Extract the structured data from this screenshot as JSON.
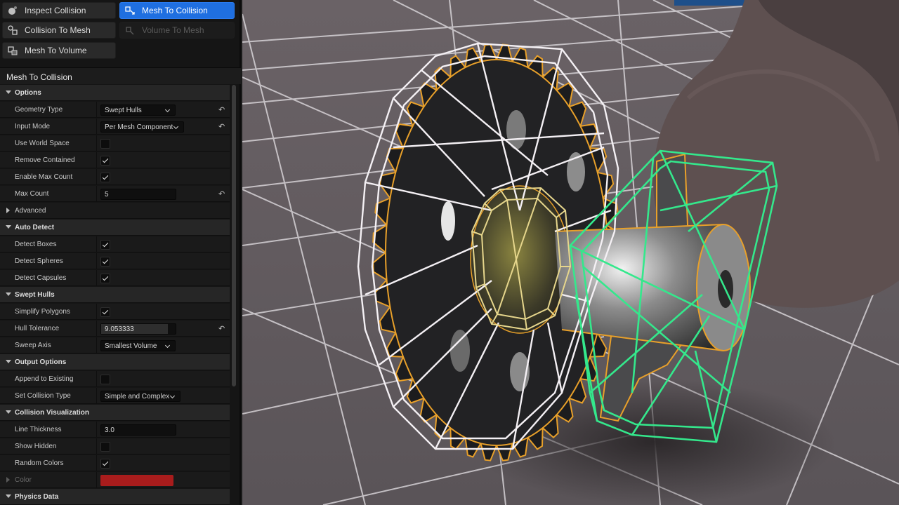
{
  "toolbar": {
    "inspect_collision": "Inspect Collision",
    "mesh_to_collision": "Mesh To Collision",
    "collision_to_mesh": "Collision To Mesh",
    "volume_to_mesh": "Volume To Mesh",
    "mesh_to_volume": "Mesh To Volume"
  },
  "panel_title": "Mesh To Collision",
  "options": {
    "section": "Options",
    "geometry_type": {
      "label": "Geometry Type",
      "value": "Swept Hulls"
    },
    "input_mode": {
      "label": "Input Mode",
      "value": "Per Mesh Component"
    },
    "use_world_space": {
      "label": "Use World Space",
      "checked": false
    },
    "remove_contained": {
      "label": "Remove Contained",
      "checked": true
    },
    "enable_max_count": {
      "label": "Enable Max Count",
      "checked": true
    },
    "max_count": {
      "label": "Max Count",
      "value": "5"
    }
  },
  "advanced": {
    "section": "Advanced"
  },
  "auto_detect": {
    "section": "Auto Detect",
    "detect_boxes": {
      "label": "Detect Boxes",
      "checked": true
    },
    "detect_spheres": {
      "label": "Detect Spheres",
      "checked": true
    },
    "detect_capsules": {
      "label": "Detect Capsules",
      "checked": true
    }
  },
  "swept_hulls": {
    "section": "Swept Hulls",
    "simplify_polygons": {
      "label": "Simplify Polygons",
      "checked": true
    },
    "hull_tolerance": {
      "label": "Hull Tolerance",
      "value": "9.053333",
      "slider_fraction": 0.9
    },
    "sweep_axis": {
      "label": "Sweep Axis",
      "value": "Smallest Volume"
    }
  },
  "output_options": {
    "section": "Output Options",
    "append_to_existing": {
      "label": "Append to Existing",
      "checked": false
    },
    "set_collision_type": {
      "label": "Set Collision Type",
      "value": "Simple and Complex"
    }
  },
  "collision_visualization": {
    "section": "Collision Visualization",
    "line_thickness": {
      "label": "Line Thickness",
      "value": "3.0"
    },
    "show_hidden": {
      "label": "Show Hidden",
      "checked": false
    },
    "random_colors": {
      "label": "Random Colors",
      "checked": true
    },
    "color": {
      "label": "Color",
      "value": "#a81c1c"
    }
  },
  "physics_data": {
    "section": "Physics Data"
  },
  "colors": {
    "accent": "#1f6fe0",
    "panel_bg": "#151515",
    "floor": "#6e6468",
    "grid_line": "#d8d4d8",
    "gear_wire": "#f4f0f4",
    "hub_wire": "#e6d68c",
    "hull_wire": "#34e88c",
    "outline": "#e8a02a"
  },
  "icons": [
    "inspect-collision-icon",
    "mesh-to-collision-icon",
    "collision-to-mesh-icon",
    "volume-to-mesh-icon",
    "mesh-to-volume-icon",
    "reset-arrow-icon"
  ]
}
